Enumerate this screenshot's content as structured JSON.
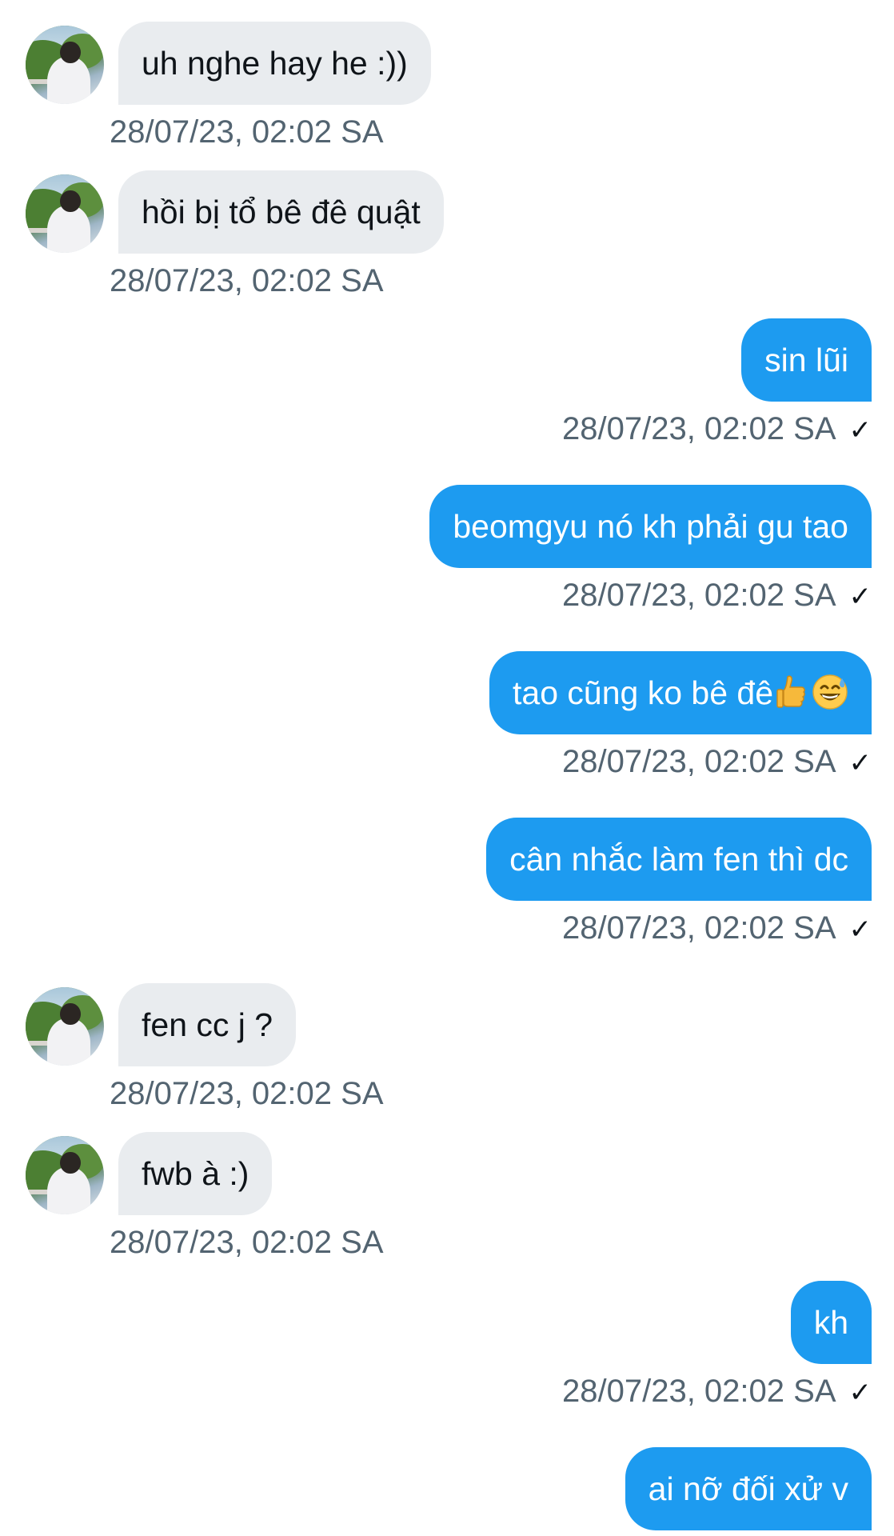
{
  "colors": {
    "incoming_bubble": "#e9ecef",
    "outgoing_bubble": "#1d9bf0",
    "timestamp": "#536471"
  },
  "messages": [
    {
      "direction": "in",
      "text": "uh nghe hay he :))",
      "time": "28/07/23, 02:02 SA"
    },
    {
      "direction": "in",
      "text": "hồi bị tổ bê đê quật",
      "time": "28/07/23, 02:02 SA"
    },
    {
      "direction": "out",
      "text": "sin lũi",
      "time": "28/07/23, 02:02 SA",
      "status_icon": "check-icon"
    },
    {
      "direction": "out",
      "text": "beomgyu nó kh phải gu tao",
      "time": "28/07/23, 02:02 SA",
      "status_icon": "check-icon"
    },
    {
      "direction": "out",
      "text": "tao cũng ko bê đê",
      "emojis": [
        "thumbs-up-icon",
        "grinning-sweat-icon"
      ],
      "time": "28/07/23, 02:02 SA",
      "status_icon": "check-icon"
    },
    {
      "direction": "out",
      "text": "cân nhắc làm fen thì dc",
      "time": "28/07/23, 02:02 SA",
      "status_icon": "check-icon"
    },
    {
      "direction": "in",
      "text": "fen cc j ?",
      "time": "28/07/23, 02:02 SA"
    },
    {
      "direction": "in",
      "text": "fwb à :)",
      "time": "28/07/23, 02:02 SA"
    },
    {
      "direction": "out",
      "text": "kh",
      "time": "28/07/23, 02:02 SA",
      "status_icon": "check-icon"
    },
    {
      "direction": "out",
      "text": "ai nỡ đối xử v"
    }
  ],
  "check_glyph": "✓"
}
